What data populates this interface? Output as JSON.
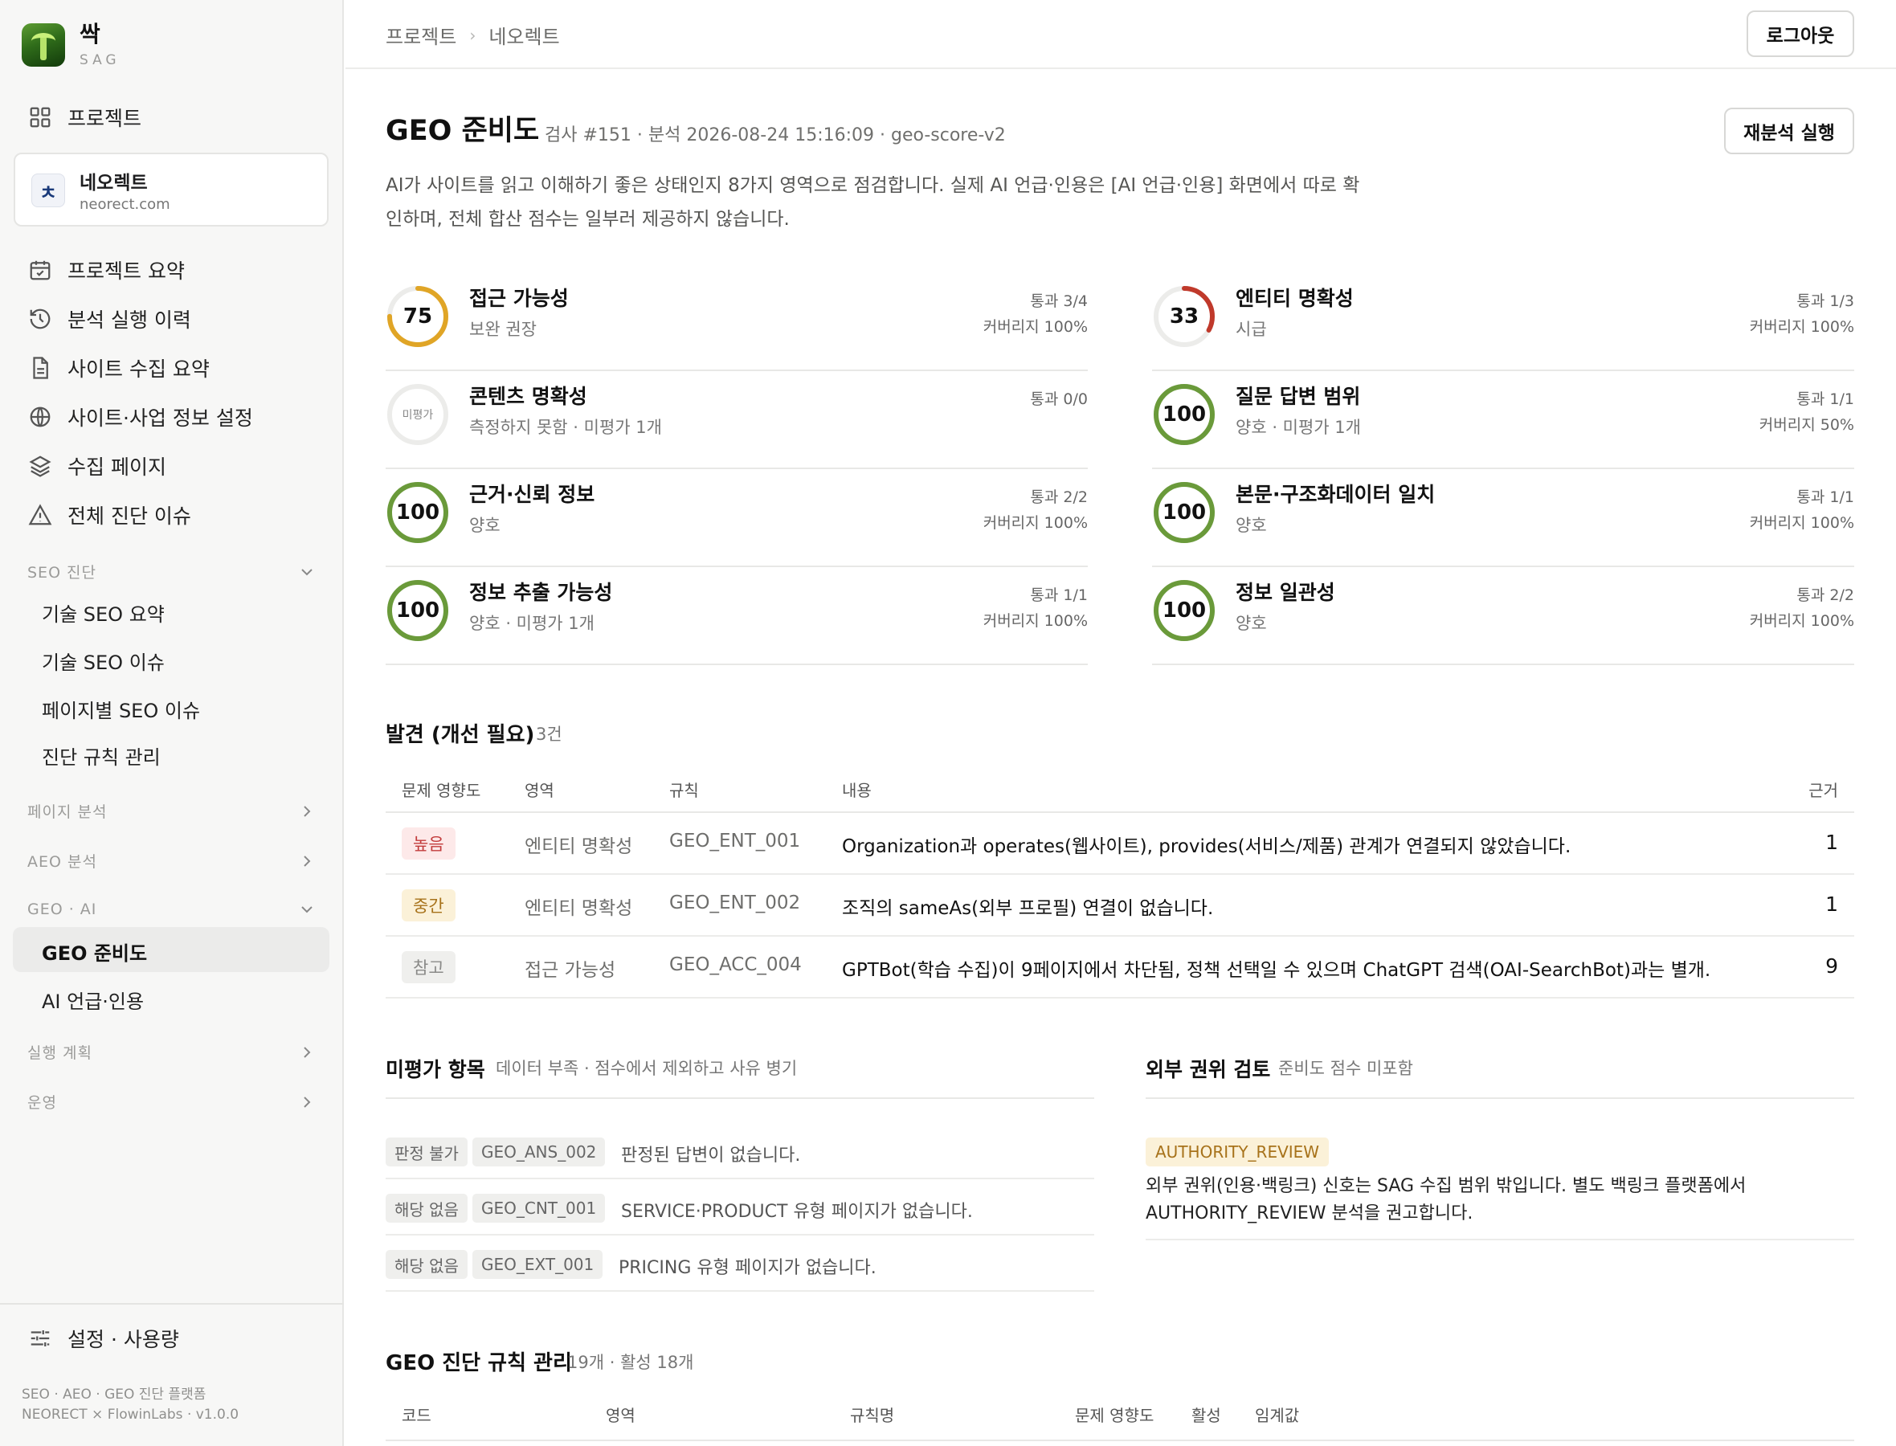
{
  "brand": {
    "name": "싹",
    "sub": "SAG"
  },
  "sidebar": {
    "projects_label": "프로젝트",
    "project": {
      "logo": "ㅊ",
      "name": "네오렉트",
      "domain": "neorect.com"
    },
    "items": [
      {
        "label": "프로젝트 요약",
        "icon": "calendar-icon"
      },
      {
        "label": "분석 실행 이력",
        "icon": "history-icon"
      },
      {
        "label": "사이트 수집 요약",
        "icon": "document-icon"
      },
      {
        "label": "사이트·사업 정보 설정",
        "icon": "globe-icon"
      },
      {
        "label": "수집 페이지",
        "icon": "layers-icon"
      },
      {
        "label": "전체 진단 이슈",
        "icon": "warning-icon"
      }
    ],
    "sections": {
      "seo": {
        "label": "SEO 진단",
        "items": [
          "기술 SEO 요약",
          "기술 SEO 이슈",
          "페이지별 SEO 이슈",
          "진단 규칙 관리"
        ]
      },
      "page": {
        "label": "페이지 분석"
      },
      "aeo": {
        "label": "AEO 분석"
      },
      "geo": {
        "label": "GEO · AI",
        "items": [
          "GEO 준비도",
          "AI 언급·인용"
        ]
      },
      "plan": {
        "label": "실행 계획"
      },
      "ops": {
        "label": "운영"
      }
    },
    "settings_label": "설정 · 사용량",
    "footer1": "SEO · AEO · GEO 진단 플랫폼",
    "footer2": "NEORECT × FlowinLabs · v1.0.0"
  },
  "header": {
    "breadcrumb": [
      "프로젝트",
      "네오렉트"
    ],
    "logout_label": "로그아웃"
  },
  "main": {
    "title": "GEO 준비도",
    "meta": "검사 #151 · 분석 2026-08-24 15:16:09 · geo-score-v2",
    "reanalyze_label": "재분석 실행",
    "description": "AI가 사이트를 읽고 이해하기 좋은 상태인지 8가지 영역으로 점검합니다. 실제 AI 언급·인용은 [AI 언급·인용] 화면에서 따로 확인하며, 전체 합산 점수는 일부러 제공하지 않습니다.",
    "scores": [
      {
        "score": "75",
        "fraction": 0.75,
        "color": "#e0a526",
        "name": "접근 가능성",
        "sub": "보완 권장",
        "pass": "통과 3/4",
        "coverage": "커버리지 100%"
      },
      {
        "score": "33",
        "fraction": 0.33,
        "color": "#c0392b",
        "name": "엔티티 명확성",
        "sub": "시급",
        "pass": "통과 1/3",
        "coverage": "커버리지 100%"
      },
      {
        "score": "미평가",
        "fraction": 0,
        "color": "#e5e5e3",
        "name": "콘텐츠 명확성",
        "sub": "측정하지 못함 · 미평가 1개",
        "pass": "통과 0/0",
        "coverage": ""
      },
      {
        "score": "100",
        "fraction": 1,
        "color": "#6a9a3a",
        "name": "질문 답변 범위",
        "sub": "양호 · 미평가 1개",
        "pass": "통과 1/1",
        "coverage": "커버리지 50%"
      },
      {
        "score": "100",
        "fraction": 1,
        "color": "#6a9a3a",
        "name": "근거·신뢰 정보",
        "sub": "양호",
        "pass": "통과 2/2",
        "coverage": "커버리지 100%"
      },
      {
        "score": "100",
        "fraction": 1,
        "color": "#6a9a3a",
        "name": "본문·구조화데이터 일치",
        "sub": "양호",
        "pass": "통과 1/1",
        "coverage": "커버리지 100%"
      },
      {
        "score": "100",
        "fraction": 1,
        "color": "#6a9a3a",
        "name": "정보 추출 가능성",
        "sub": "양호 · 미평가 1개",
        "pass": "통과 1/1",
        "coverage": "커버리지 100%"
      },
      {
        "score": "100",
        "fraction": 1,
        "color": "#6a9a3a",
        "name": "정보 일관성",
        "sub": "양호",
        "pass": "통과 2/2",
        "coverage": "커버리지 100%"
      }
    ],
    "findings": {
      "title": "발견 (개선 필요)",
      "count": "3건",
      "headers": [
        "문제 영향도",
        "영역",
        "규칙",
        "내용",
        "근거"
      ],
      "rows": [
        {
          "severity": "높음",
          "area": "엔티티 명확성",
          "rule": "GEO_ENT_001",
          "content": "Organization과 operates(웹사이트), provides(서비스/제품) 관계가 연결되지 않았습니다.",
          "evidence": "1"
        },
        {
          "severity": "중간",
          "area": "엔티티 명확성",
          "rule": "GEO_ENT_002",
          "content": "조직의 sameAs(외부 프로필) 연결이 없습니다.",
          "evidence": "1"
        },
        {
          "severity": "참고",
          "area": "접근 가능성",
          "rule": "GEO_ACC_004",
          "content": "GPTBot(학습 수집)이 9페이지에서 차단됨, 정책 선택일 수 있으며 ChatGPT 검색(OAI-SearchBot)과는 별개.",
          "evidence": "9"
        }
      ]
    },
    "unevaluated": {
      "title": "미평가 항목",
      "meta": "데이터 부족 · 점수에서 제외하고 사유 병기",
      "rows": [
        {
          "status": "판정 불가",
          "code": "GEO_ANS_002",
          "text": "판정된 답변이 없습니다."
        },
        {
          "status": "해당 없음",
          "code": "GEO_CNT_001",
          "text": "SERVICE·PRODUCT 유형 페이지가 없습니다."
        },
        {
          "status": "해당 없음",
          "code": "GEO_EXT_001",
          "text": "PRICING 유형 페이지가 없습니다."
        }
      ]
    },
    "external": {
      "title": "외부 권위 검토",
      "meta": "준비도 점수 미포함",
      "badge": "AUTHORITY_REVIEW",
      "text": "외부 권위(인용·백링크) 신호는 SAG 수집 범위 밖입니다. 별도 백링크 플랫폼에서 AUTHORITY_REVIEW 분석을 권고합니다."
    },
    "rules": {
      "title": "GEO 진단 규칙 관리",
      "meta": "19개 · 활성 18개",
      "headers": [
        "코드",
        "영역",
        "규칙명",
        "문제 영향도",
        "활성",
        "임계값"
      ]
    }
  }
}
